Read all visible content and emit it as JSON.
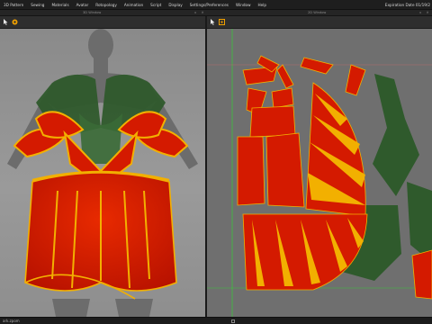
{
  "menubar": {
    "items": [
      "3D Pattern",
      "Sewing",
      "Materials",
      "Avatar",
      "Rotopology",
      "Animation",
      "Script",
      "Display",
      "Settings/Preferences",
      "Window",
      "Help"
    ],
    "expiration": "Expiration Date 01/19/2"
  },
  "windows": {
    "left_title": "3D Window",
    "right_title": "2D Window"
  },
  "status": {
    "label": "ark.zpom"
  },
  "colors": {
    "garment_red": "#d41a00",
    "garment_yellow": "#f2b000",
    "garment_green": "#2f5a2c",
    "avatar_gray": "#6e6e6e",
    "viewport_3d": "#8f8f8f",
    "viewport_2d": "#6f6f6f",
    "axis_green": "#3cc43c"
  },
  "icons": {
    "left_toolbar": [
      "pointer-icon",
      "move-icon"
    ],
    "right_toolbar": [
      "pattern-pointer-icon",
      "transform-icon"
    ]
  }
}
